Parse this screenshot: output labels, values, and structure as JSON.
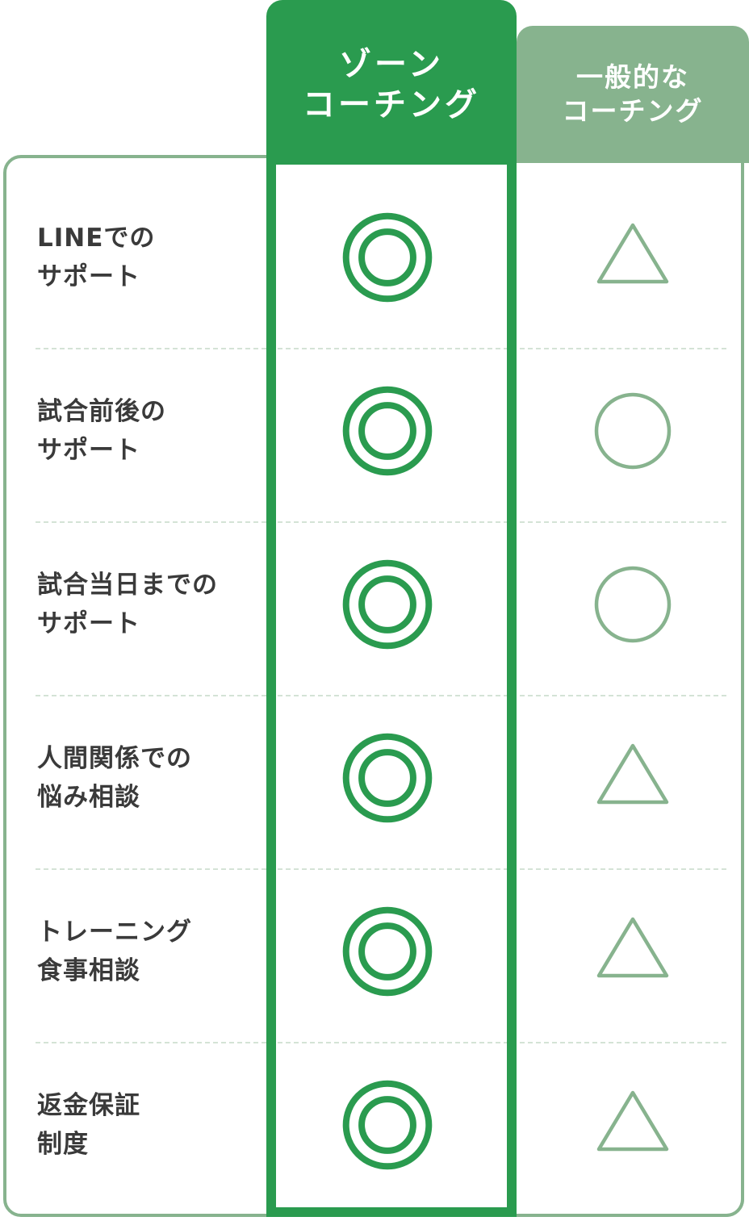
{
  "header": {
    "zone_line1": "ゾーン",
    "zone_line2": "コーチング",
    "general_line1": "一般的な",
    "general_line2": "コーチング"
  },
  "rows": [
    {
      "label_line1": "LINEでの",
      "label_line2": "サポート",
      "zone": "double-circle-icon",
      "general": "triangle-icon"
    },
    {
      "label_line1": "試合前後の",
      "label_line2": "サポート",
      "zone": "double-circle-icon",
      "general": "circle-icon"
    },
    {
      "label_line1": "試合当日までの",
      "label_line2": "サポート",
      "zone": "double-circle-icon",
      "general": "circle-icon"
    },
    {
      "label_line1": "人間関係での",
      "label_line2": "悩み相談",
      "zone": "double-circle-icon",
      "general": "triangle-icon"
    },
    {
      "label_line1": "トレーニング",
      "label_line2": "食事相談",
      "zone": "double-circle-icon",
      "general": "triangle-icon"
    },
    {
      "label_line1": "返金保証",
      "label_line2": "制度",
      "zone": "double-circle-icon",
      "general": "triangle-icon"
    }
  ],
  "colors": {
    "zone_green": "#2a9b4f",
    "general_green": "#87b38e",
    "label_text": "#3a3a3a",
    "divider": "#d4e3d6"
  }
}
